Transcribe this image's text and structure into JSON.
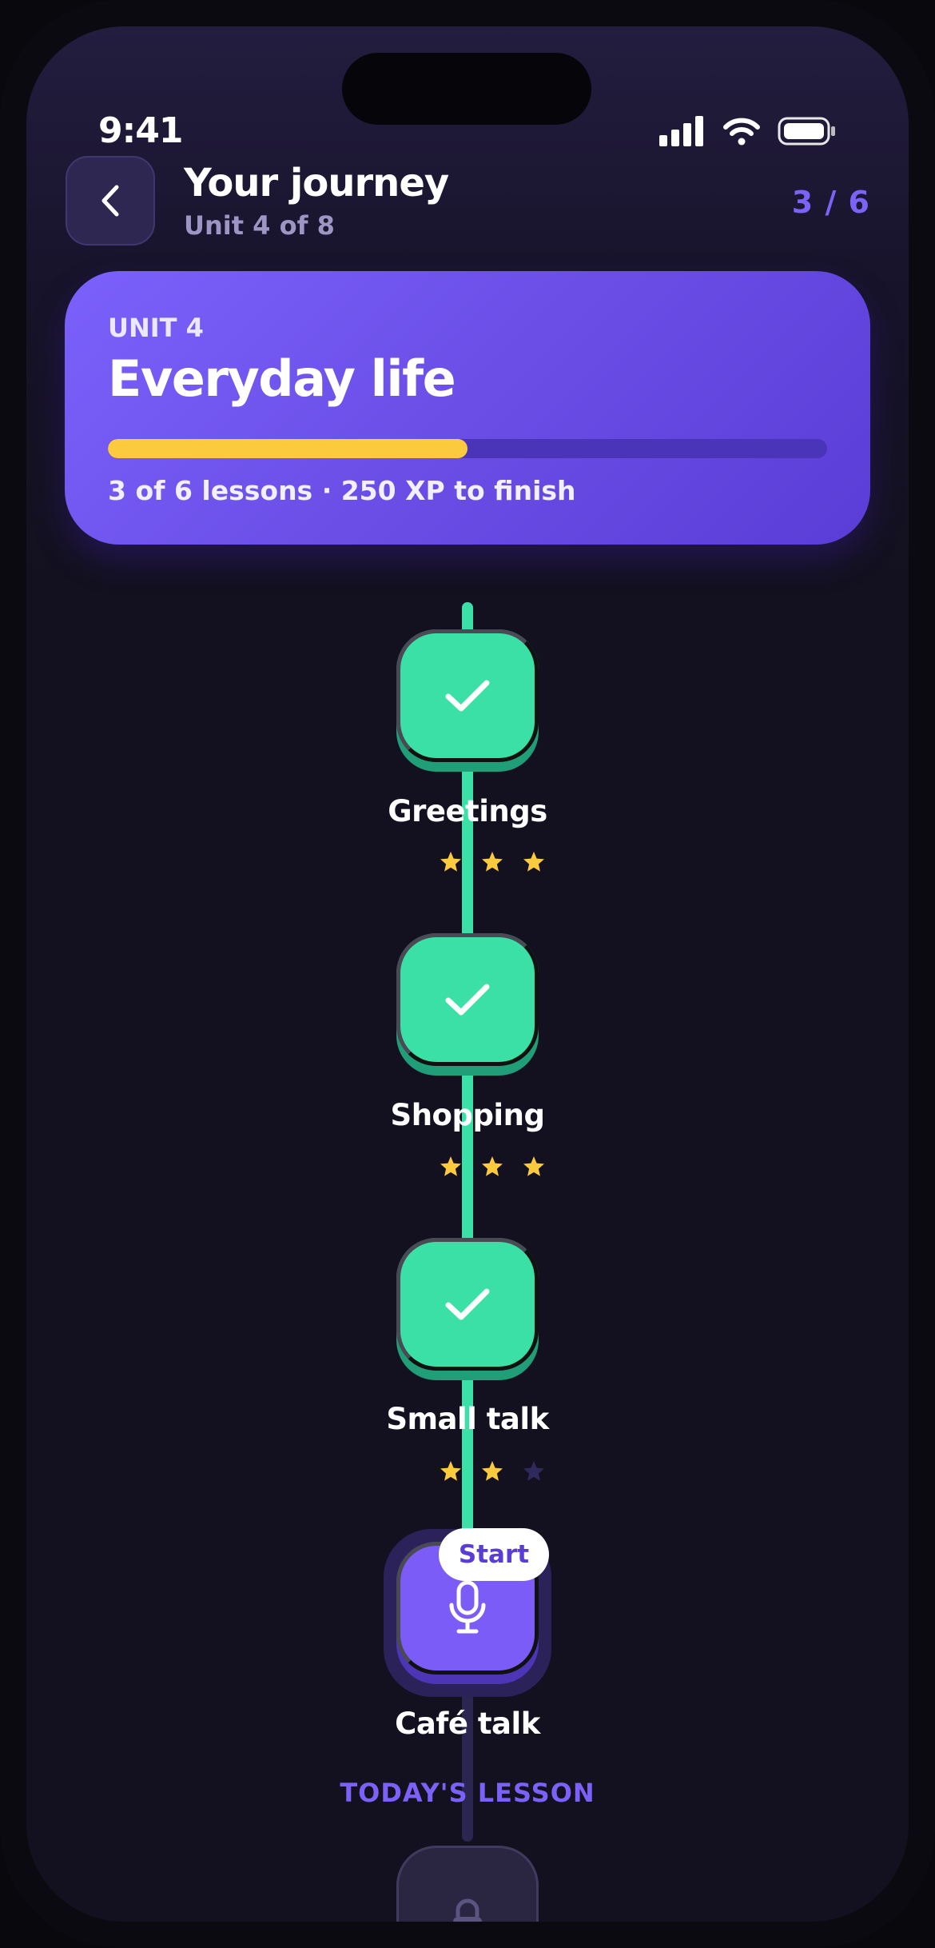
{
  "status_bar": {
    "time": "9:41"
  },
  "header": {
    "title": "Your journey",
    "subtitle": "Unit 4 of 8",
    "counter": "3 / 6"
  },
  "unit_card": {
    "label": "UNIT 4",
    "title": "Everyday life",
    "progress": 0.5,
    "meta": "3 of 6 lessons · 250 XP to finish"
  },
  "lessons": [
    {
      "title": "Greetings",
      "state": "completed",
      "icon": "check-icon",
      "stars": 3
    },
    {
      "title": "Shopping",
      "state": "completed",
      "icon": "check-icon",
      "stars": 3
    },
    {
      "title": "Small talk",
      "state": "completed",
      "icon": "check-icon",
      "stars": 2
    },
    {
      "title": "Café talk",
      "state": "current",
      "icon": "microphone-icon",
      "badge": "TODAY'S LESSON",
      "action": "Start"
    },
    {
      "state": "locked",
      "icon": "lock-icon"
    }
  ],
  "colors": {
    "accent": "#7B61FB",
    "completed": "#3AE0A6",
    "star": "#FCCA3D",
    "star_empty": "#2F2A5C",
    "background": "#13111F"
  }
}
